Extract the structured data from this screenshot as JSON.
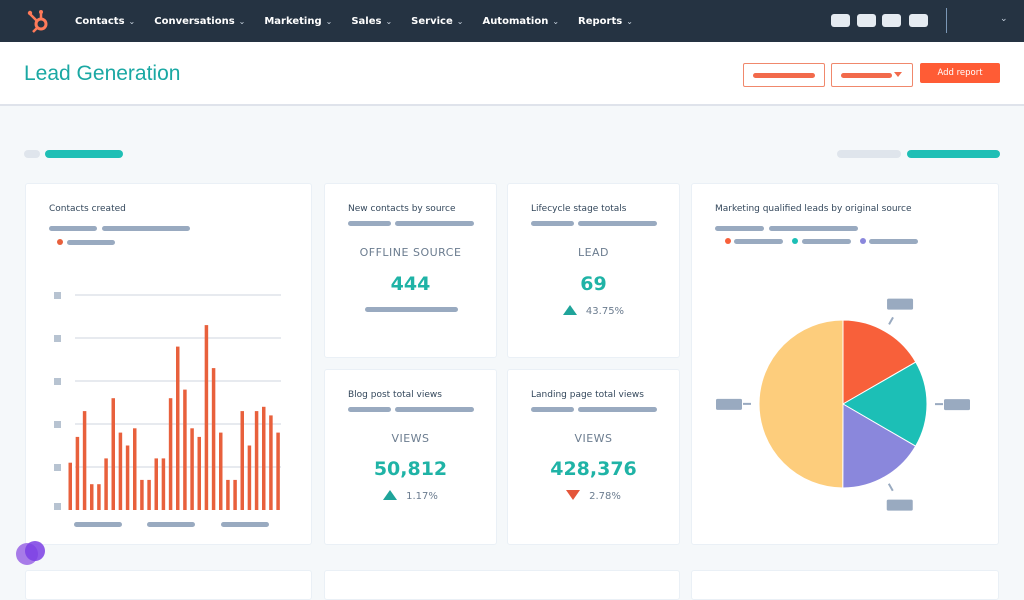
{
  "nav": {
    "items": [
      {
        "label": "Contacts"
      },
      {
        "label": "Conversations"
      },
      {
        "label": "Marketing"
      },
      {
        "label": "Sales"
      },
      {
        "label": "Service"
      },
      {
        "label": "Automation"
      },
      {
        "label": "Reports"
      }
    ],
    "chevron": "⌄"
  },
  "header": {
    "title": "Lead Generation",
    "add_report_label": "Add report"
  },
  "colors": {
    "nav": "#253342",
    "accent": "#1fb3a6",
    "brand": "#ff5c35",
    "bar": "#e8603c"
  },
  "cards": {
    "contacts_created": {
      "title": "Contacts created"
    },
    "new_contacts": {
      "title": "New contacts by source",
      "label": "OFFLINE SOURCE",
      "value": "444"
    },
    "lifecycle": {
      "title": "Lifecycle stage totals",
      "label": "LEAD",
      "value": "69",
      "change": "43.75%",
      "direction": "up"
    },
    "blog": {
      "title": "Blog post total views",
      "label": "VIEWS",
      "value": "50,812",
      "change": "1.17%",
      "direction": "up"
    },
    "landing": {
      "title": "Landing page total views",
      "label": "VIEWS",
      "value": "428,376",
      "change": "2.78%",
      "direction": "down"
    },
    "mql": {
      "title": "Marketing qualified leads by original source"
    }
  },
  "chart_data": [
    {
      "type": "bar",
      "title": "Contacts created",
      "values": [
        1.1,
        1.7,
        2.3,
        0.6,
        0.6,
        1.2,
        2.6,
        1.8,
        1.5,
        1.9,
        0.7,
        0.7,
        1.2,
        1.2,
        2.6,
        3.8,
        2.8,
        1.9,
        1.7,
        4.3,
        3.3,
        1.8,
        0.7,
        0.7,
        2.3,
        1.5,
        2.3,
        2.4,
        2.2,
        1.8
      ],
      "ylim": [
        0,
        5
      ],
      "grid": true,
      "color": "#e8603c"
    },
    {
      "type": "pie",
      "title": "Marketing qualified leads by original source",
      "values": [
        16.7,
        16.7,
        16.7,
        50
      ],
      "colors": [
        "#f8603a",
        "#1cbfb6",
        "#8a87dc",
        "#fdcd7c"
      ]
    }
  ]
}
